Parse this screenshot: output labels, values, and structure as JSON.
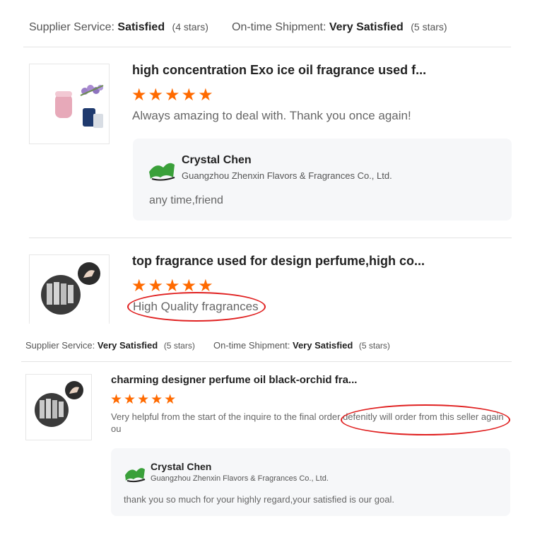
{
  "summary_top": {
    "supplier_label": "Supplier Service:",
    "supplier_value": "Satisfied",
    "supplier_count": "(4 stars)",
    "shipment_label": "On-time Shipment:",
    "shipment_value": "Very Satisfied",
    "shipment_count": "(5 stars)"
  },
  "reviews": [
    {
      "title": "high concentration Exo ice oil fragrance used f...",
      "stars": "★★★★★",
      "comment": "Always amazing to deal with. Thank you once again!",
      "reply": {
        "name": "Crystal Chen",
        "company": "Guangzhou Zhenxin Flavors & Fragrances Co., Ltd.",
        "text": "any time,friend"
      }
    },
    {
      "title": "top fragrance used for design perfume,high co...",
      "stars": "★★★★★",
      "comment": "High Quality fragrances"
    }
  ],
  "summary_bottom": {
    "supplier_label": "Supplier Service:",
    "supplier_value": "Very Satisfied",
    "supplier_count": "(5 stars)",
    "shipment_label": "On-time Shipment:",
    "shipment_value": "Very Satisfied",
    "shipment_count": "(5 stars)"
  },
  "review3": {
    "title": "charming designer perfume oil black-orchid fra...",
    "stars": "★★★★★",
    "comment_line1": "Very helpful from the start of the inquire to the final order defenitly will order from this seller again",
    "comment_line2": "ou",
    "reply": {
      "name": "Crystal Chen",
      "company": "Guangzhou Zhenxin Flavors & Fragrances Co., Ltd.",
      "text": "thank you so much for your highly regard,your satisfied is our goal."
    }
  },
  "colors": {
    "star": "#ff6a00",
    "annotation": "#e02020",
    "reply_bg": "#f6f7f9"
  }
}
